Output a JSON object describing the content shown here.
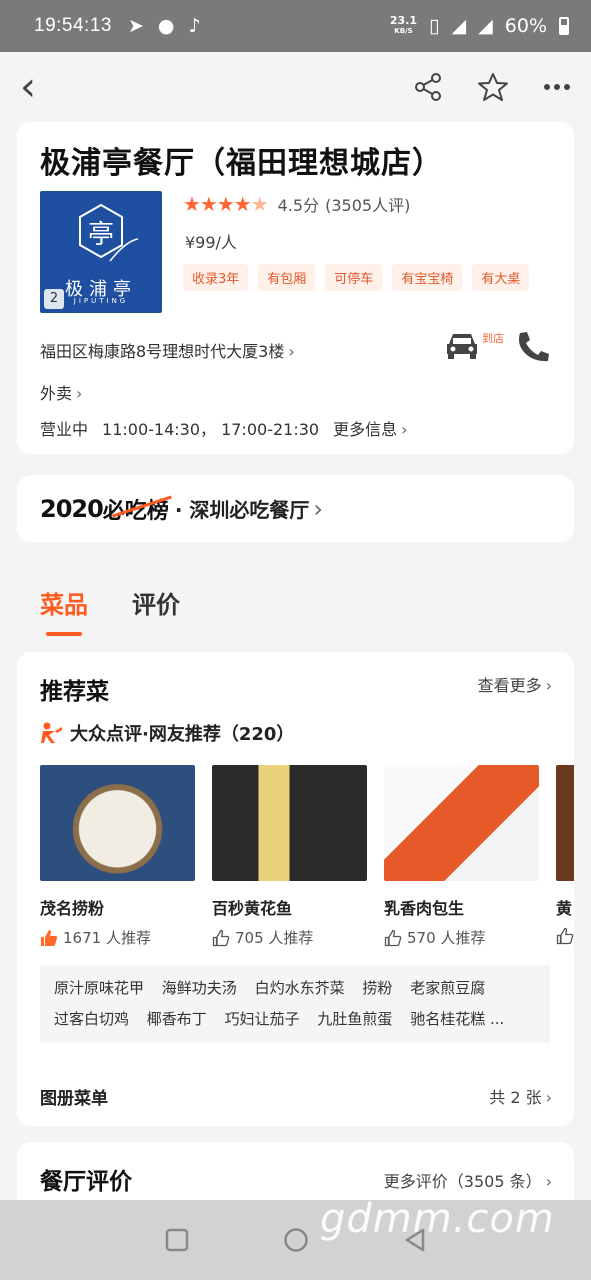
{
  "status_bar": {
    "time": "19:54:13",
    "speed_value": "23.1",
    "speed_unit": "KB/S",
    "battery": "60%"
  },
  "shop": {
    "name": "极浦亭餐厅（福田理想城店）",
    "logo_text": "极浦亭",
    "logo_en": "JIPUTING",
    "photo_count": "2",
    "rating": "4.5分",
    "review_count": "(3505人评)",
    "price": "¥99/人",
    "tags": [
      "收录3年",
      "有包厢",
      "可停车",
      "有宝宝椅",
      "有大桌"
    ],
    "address": "福田区梅康路8号理想时代大厦3楼",
    "arrive_label": "到店",
    "takeaway": "外卖",
    "status": "营业中",
    "hours": "11:00-14:30， 17:00-21:30",
    "more_info": "更多信息"
  },
  "ranking": {
    "year": "2020",
    "list_name": "必吃榜",
    "label": "· 深圳必吃餐厅"
  },
  "tabs": [
    {
      "label": "菜品"
    },
    {
      "label": "评价"
    }
  ],
  "dishes_section": {
    "title": "推荐菜",
    "see_more": "查看更多",
    "source": "大众点评·网友推荐（220）",
    "dishes": [
      {
        "name": "茂名捞粉",
        "recommend": "1671 人推荐"
      },
      {
        "name": "百秒黄花鱼",
        "recommend": "705 人推荐"
      },
      {
        "name": "乳香肉包生",
        "recommend": "570 人推荐"
      },
      {
        "name": "黄",
        "recommend": ""
      }
    ],
    "tags": [
      "原汁原味花甲",
      "海鲜功夫汤",
      "白灼水东芥菜",
      "捞粉",
      "老家煎豆腐",
      "过客白切鸡",
      "椰香布丁",
      "巧妇让茄子",
      "九肚鱼煎蛋",
      "驰名桂花糕 ..."
    ],
    "album_label": "图册菜单",
    "album_count": "共 2 张"
  },
  "reviews_section": {
    "title": "餐厅评价",
    "more": "更多评价（3505 条）"
  },
  "watermark": "gdmm.com",
  "colors": {
    "accent": "#ff5a1f",
    "tag_bg": "#fff0ea",
    "logo_bg": "#1f4fa0"
  }
}
